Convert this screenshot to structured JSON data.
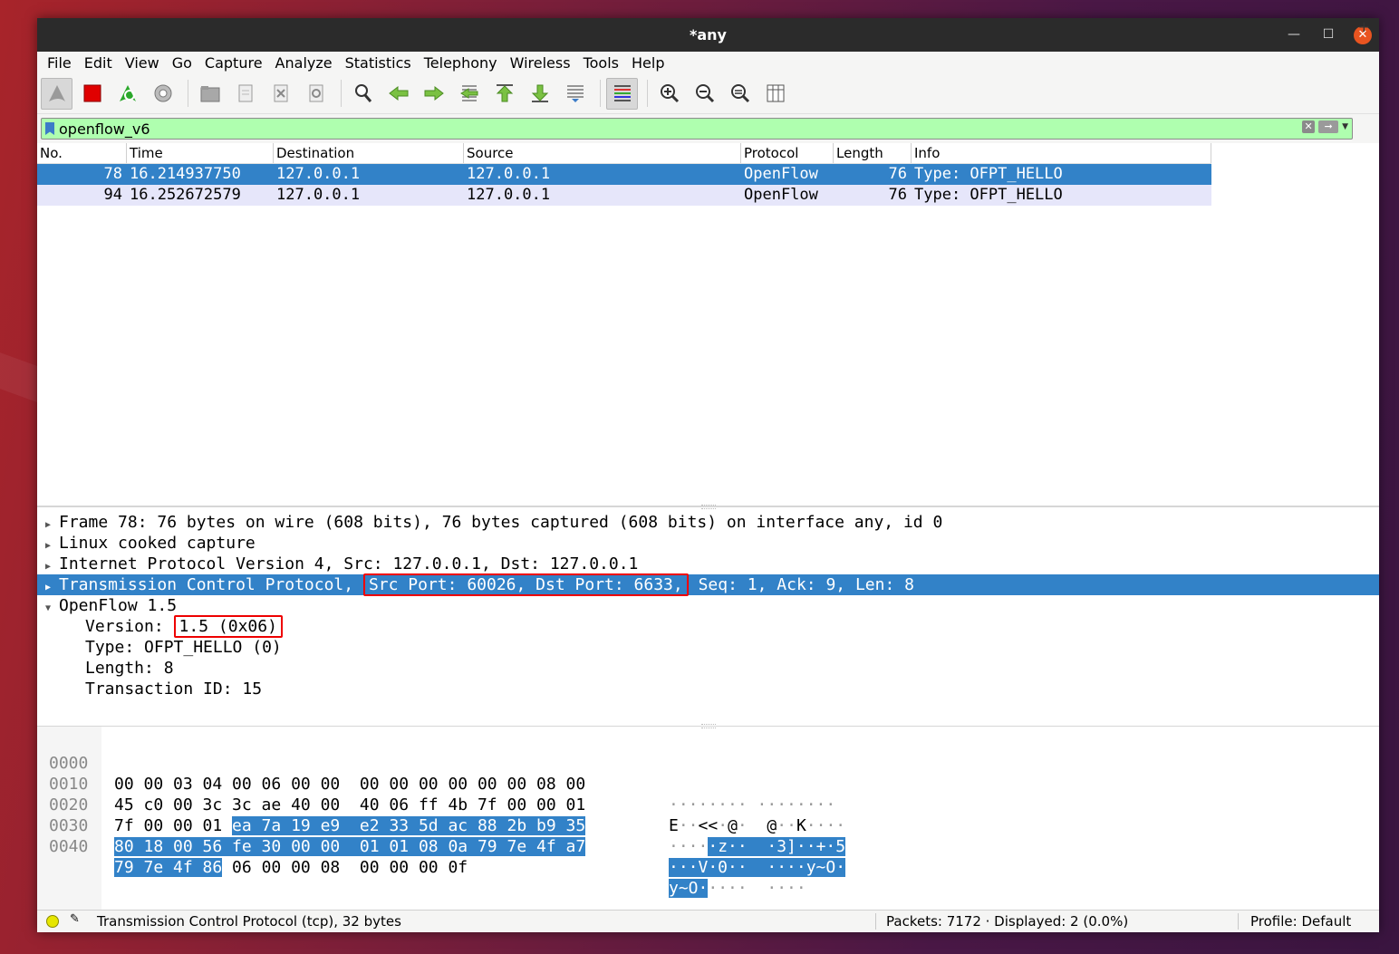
{
  "window": {
    "title": "*any"
  },
  "menu": [
    "File",
    "Edit",
    "View",
    "Go",
    "Capture",
    "Analyze",
    "Statistics",
    "Telephony",
    "Wireless",
    "Tools",
    "Help"
  ],
  "filter": {
    "value": "openflow_v6"
  },
  "packet_list": {
    "columns": [
      "No.",
      "Time",
      "Destination",
      "Source",
      "Protocol",
      "Length",
      "Info"
    ],
    "rows": [
      {
        "no": "78",
        "time": "16.214937750",
        "dst": "127.0.0.1",
        "src": "127.0.0.1",
        "proto": "OpenFlow",
        "len": "76",
        "info": "Type: OFPT_HELLO"
      },
      {
        "no": "94",
        "time": "16.252672579",
        "dst": "127.0.0.1",
        "src": "127.0.0.1",
        "proto": "OpenFlow",
        "len": "76",
        "info": "Type: OFPT_HELLO"
      }
    ]
  },
  "details": {
    "frame": "Frame 78: 76 bytes on wire (608 bits), 76 bytes captured (608 bits) on interface any, id 0",
    "linux": "Linux cooked capture",
    "ip": "Internet Protocol Version 4, Src: 127.0.0.1, Dst: 127.0.0.1",
    "tcp_a": "Transmission Control Protocol, ",
    "tcp_b": "Src Port: 60026, Dst Port: 6633,",
    "tcp_c": " Seq: 1, Ack: 9, Len: 8",
    "openflow": "OpenFlow 1.5",
    "version_label": "Version: ",
    "version_value": "1.5 (0x06)",
    "type": "Type: OFPT_HELLO (0)",
    "length": "Length: 8",
    "xid": "Transaction ID: 15"
  },
  "bytes": {
    "offsets": [
      "0000",
      "0010",
      "0020",
      "0030",
      "0040"
    ],
    "r0_hex": "00 00 03 04 00 06 00 00  00 00 00 00 00 00 08 00",
    "r0_asc": "········ ········",
    "r1_hex": "45 c0 00 3c 3c ae 40 00  40 06 ff 4b 7f 00 00 01",
    "r1_asc_a": "E",
    "r1_asc_b": "··",
    "r1_asc_c": "<<",
    "r1_asc_d": "·",
    "r1_asc_e": "@",
    "r1_asc_f": "·  ",
    "r1_asc_g": "@",
    "r1_asc_h": "··",
    "r1_asc_i": "K",
    "r1_asc_j": "····",
    "r2_hex_a": "7f 00 00 01 ",
    "r2_hex_b": "ea 7a 19 e9  e2 33 5d ac 88 2b b9 35",
    "r2_asc_a": "····",
    "r2_asc_b": "·z··  ·3]··+·5",
    "r3_hex": "80 18 00 56 fe 30 00 00  01 01 08 0a 79 7e 4f a7",
    "r3_asc": "···V·0··  ····y~O·",
    "r4_hex_a": "79 7e 4f 86",
    "r4_hex_b": " 06 00 00 08  00 00 00 0f",
    "r4_asc_a": "y~O·",
    "r4_asc_b": "····  ····"
  },
  "status": {
    "text": "Transmission Control Protocol (tcp), 32 bytes",
    "packets": "Packets: 7172 · Displayed: 2 (0.0%)",
    "profile": "Profile: Default"
  },
  "colors": {
    "selection": "#3282c8",
    "filter_ok": "#afffaf",
    "highlight": "#e00000",
    "alt_row": "#e6e6fa"
  }
}
